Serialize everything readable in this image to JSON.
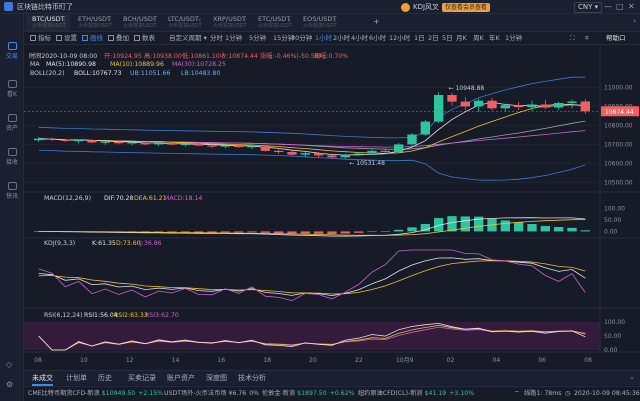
{
  "app": {
    "title": "区块链比特币盯了",
    "user": "KDJ风叉",
    "vip_label": "仅查看会员查看",
    "currency": "CNY"
  },
  "window_buttons": [
    "—",
    "□",
    "✕"
  ],
  "sidebar": {
    "items": [
      {
        "label": "交易",
        "icon": "chart-icon"
      },
      {
        "label": "看K",
        "icon": "candle-icon"
      },
      {
        "label": "资产",
        "icon": "wallet-icon"
      },
      {
        "label": "接收",
        "icon": "receive-icon"
      },
      {
        "label": "快讯",
        "icon": "news-icon"
      }
    ]
  },
  "tabs": [
    {
      "name": "BTC/USDT",
      "sub": "火币现货USDT"
    },
    {
      "name": "ETH/USDT",
      "sub": "火币现货USDT"
    },
    {
      "name": "BCH/USDT",
      "sub": "火币现货USDT"
    },
    {
      "name": "LTC/USDT",
      "sub": "火币现货USDT"
    },
    {
      "name": "XRP/USDT",
      "sub": "火币现货USDT"
    },
    {
      "name": "ETC/USDT",
      "sub": "火币现货USDT"
    },
    {
      "name": "EOS/USDT",
      "sub": "火币现货USDT"
    }
  ],
  "toolbar": {
    "tools": [
      "指标",
      "设置",
      "画线",
      "叠加",
      "数表"
    ],
    "custom_period": "自定义周期",
    "periods": [
      "分时",
      "1分钟",
      "5分钟",
      "15分钟",
      "30分钟",
      "1小时",
      "2小时",
      "4小时",
      "6小时",
      "12小时",
      "1日",
      "2日",
      "5日",
      "月K",
      "周K",
      "年K",
      "1分钟"
    ],
    "active_period": "1小时",
    "help": "帮助口"
  },
  "chart_data": [
    {
      "type": "candlestick",
      "legend": {
        "date": "时间2020-10-09 08:00",
        "open": "开:10924.95",
        "high": "高:10938.00",
        "low": "低:10861.10",
        "close": "收:10874.44",
        "change": "涨幅:-0.46%(-50.50)",
        "amp": "振幅:0.70%"
      },
      "ma_legend": {
        "name": "MA",
        "ma5": "MA(5):10890.98",
        "ma10": "MA(10):10889.96",
        "ma30": "MA(30):10728.25"
      },
      "boll_legend": {
        "name": "BOLL(20,2)",
        "boll": "BOLL:10767.73",
        "ub": "UB:11051.66",
        "lb": "LB:10483.80"
      },
      "y_ticks": [
        "11000.00",
        "10900.00",
        "10800.00",
        "10700.00",
        "10600.00",
        "10500.00"
      ],
      "ylim": [
        10460,
        11060
      ],
      "annotations": [
        "10948.88",
        "10531.48"
      ],
      "current_price": "10874.44",
      "candles": [
        [
          10722,
          10738,
          10712,
          10730
        ],
        [
          10730,
          10736,
          10718,
          10725
        ],
        [
          10725,
          10730,
          10712,
          10718
        ],
        [
          10718,
          10726,
          10705,
          10722
        ],
        [
          10722,
          10728,
          10706,
          10710
        ],
        [
          10710,
          10720,
          10698,
          10714
        ],
        [
          10714,
          10720,
          10700,
          10706
        ],
        [
          10706,
          10716,
          10694,
          10710
        ],
        [
          10710,
          10715,
          10696,
          10700
        ],
        [
          10700,
          10712,
          10690,
          10706
        ],
        [
          10706,
          10714,
          10695,
          10699
        ],
        [
          10699,
          10708,
          10688,
          10702
        ],
        [
          10702,
          10708,
          10690,
          10694
        ],
        [
          10694,
          10700,
          10682,
          10690
        ],
        [
          10690,
          10698,
          10680,
          10694
        ],
        [
          10694,
          10700,
          10682,
          10686
        ],
        [
          10686,
          10695,
          10675,
          10690
        ],
        [
          10690,
          10694,
          10662,
          10666
        ],
        [
          10666,
          10674,
          10650,
          10660
        ],
        [
          10660,
          10668,
          10640,
          10646
        ],
        [
          10646,
          10660,
          10632,
          10654
        ],
        [
          10654,
          10660,
          10630,
          10642
        ],
        [
          10642,
          10652,
          10626,
          10632
        ],
        [
          10632,
          10650,
          10624,
          10646
        ],
        [
          10646,
          10660,
          10640,
          10652
        ],
        [
          10652,
          10672,
          10644,
          10666
        ],
        [
          10666,
          10680,
          10650,
          10660
        ],
        [
          10660,
          10708,
          10655,
          10700
        ],
        [
          10700,
          10760,
          10690,
          10752
        ],
        [
          10752,
          10830,
          10745,
          10820
        ],
        [
          10820,
          10975,
          10812,
          10960
        ],
        [
          10960,
          10972,
          10905,
          10925
        ],
        [
          10925,
          10949,
          10880,
          10900
        ],
        [
          10900,
          10940,
          10870,
          10930
        ],
        [
          10930,
          10945,
          10880,
          10890
        ],
        [
          10890,
          10915,
          10872,
          10906
        ],
        [
          10906,
          10924,
          10880,
          10896
        ],
        [
          10896,
          10930,
          10875,
          10910
        ],
        [
          10910,
          10935,
          10886,
          10894
        ],
        [
          10894,
          10925,
          10880,
          10918
        ],
        [
          10918,
          10936,
          10890,
          10926
        ],
        [
          10926,
          10938,
          10861,
          10874
        ]
      ]
    },
    {
      "type": "macd",
      "legend": {
        "name": "MACD(12,26,9)",
        "dif": "DIF:70.28",
        "dea": "DEA:61.21",
        "macd": "MACD:18.14"
      },
      "y_ticks": [
        "100.00",
        "50.00",
        "0.00"
      ],
      "ylim": [
        -20,
        120
      ]
    },
    {
      "type": "kdj",
      "legend": {
        "name": "KDJ(9,3,3)",
        "k": "K:61.35",
        "d": "D:73.60",
        "j": "J:36.86"
      }
    },
    {
      "type": "rsi",
      "legend": {
        "name": "RSI(6,12,24)",
        "rsi1": "RSI1:56.04",
        "rsi2": "RSI2:63.33",
        "rsi3": "RSI3:62.70"
      },
      "y_ticks": [
        "100.00",
        "50.00",
        "0.00"
      ],
      "ylim": [
        0,
        100
      ]
    }
  ],
  "x_labels": [
    "08",
    "10",
    "12",
    "14",
    "16",
    "18",
    "20",
    "22",
    "10月9",
    "02",
    "04",
    "06",
    "08"
  ],
  "bottom_tabs": [
    "未成交",
    "计划单",
    "历史",
    "买卖记录",
    "账户资产",
    "深度图",
    "技术分析"
  ],
  "status": [
    {
      "name": "CME比特币期货CFD-新浪",
      "value": "$10949.50",
      "change": "+2.15%"
    },
    {
      "name": "USDT场外-火币法币场",
      "value": "¥6.76",
      "change": "0%"
    },
    {
      "name": "伦敦金-新浪",
      "value": "$1897.50",
      "change": "+0.62%"
    },
    {
      "name": "纽约原油CFD(CL)-新浪",
      "value": "$41.19",
      "change": "+3.10%"
    }
  ],
  "latency": "线路1: 78ms",
  "clock": "2020-10-09 08:45:36",
  "colors": {
    "up": "#2ec4a0",
    "down": "#f06060",
    "accent": "#3e8bf0"
  }
}
